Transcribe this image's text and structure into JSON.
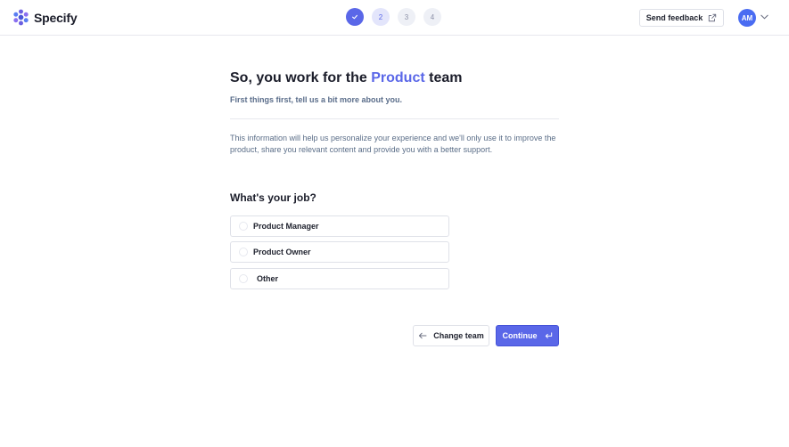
{
  "app": {
    "name": "Specify"
  },
  "steps": [
    {
      "label": "",
      "state": "done"
    },
    {
      "label": "2",
      "state": "current"
    },
    {
      "label": "3",
      "state": "upcoming"
    },
    {
      "label": "4",
      "state": "upcoming"
    }
  ],
  "header": {
    "feedback_label": "Send feedback",
    "avatar_initials": "AM"
  },
  "main": {
    "title_prefix": "So, you work for the ",
    "title_highlight": "Product",
    "title_suffix": " team",
    "subtitle": "First things first, tell us a bit more about you.",
    "info": "This information will help us personalize your experience and we'll only use it to improve the product, share you relevant content and provide you with a better support.",
    "question": "What's your job?",
    "options": [
      {
        "label": "Product Manager"
      },
      {
        "label": "Product Owner"
      },
      {
        "label": "Other"
      }
    ],
    "back_label": "Change team",
    "continue_label": "Continue"
  },
  "colors": {
    "accent": "#5a67e8",
    "avatar": "#4a6cf2",
    "subtitle": "#5a6d8a"
  }
}
